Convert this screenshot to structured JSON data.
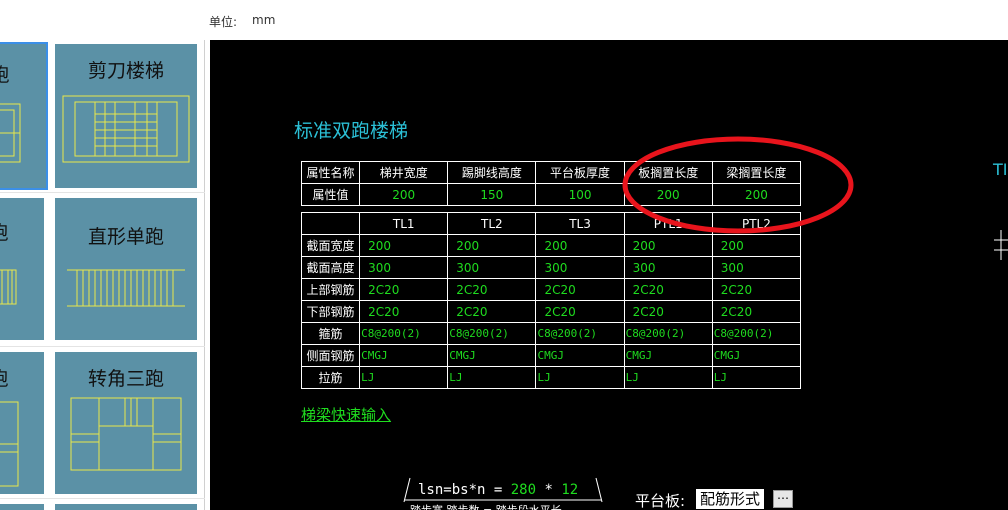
{
  "topbar": {
    "unit_label": "单位:",
    "unit_value": "mm"
  },
  "templates": [
    {
      "label": "跑",
      "selected": true
    },
    {
      "label": "剪刀楼梯"
    },
    {
      "label": "跑"
    },
    {
      "label": "直形单跑"
    },
    {
      "label": "跑"
    },
    {
      "label": "转角三跑"
    }
  ],
  "cad": {
    "title": "标准双跑楼梯",
    "properties": {
      "headers": [
        "属性名称",
        "梯井宽度",
        "踢脚线高度",
        "平台板厚度",
        "板搁置长度",
        "梁搁置长度"
      ],
      "row_label": "属性值",
      "values": [
        "200",
        "150",
        "100",
        "200",
        "200"
      ]
    },
    "beams": {
      "columns": [
        "TL1",
        "TL2",
        "TL3",
        "PTL1",
        "PTL2"
      ],
      "rows": [
        {
          "label": "截面宽度",
          "values": [
            "200",
            "200",
            "200",
            "200",
            "200"
          ]
        },
        {
          "label": "截面高度",
          "values": [
            "300",
            "300",
            "300",
            "300",
            "300"
          ]
        },
        {
          "label": "上部钢筋",
          "values": [
            "2C20",
            "2C20",
            "2C20",
            "2C20",
            "2C20"
          ]
        },
        {
          "label": "下部钢筋",
          "values": [
            "2C20",
            "2C20",
            "2C20",
            "2C20",
            "2C20"
          ]
        },
        {
          "label": "箍筋",
          "values": [
            "C8@200(2)",
            "C8@200(2)",
            "C8@200(2)",
            "C8@200(2)",
            "C8@200(2)"
          ]
        },
        {
          "label": "侧面钢筋",
          "values": [
            "CMGJ",
            "CMGJ",
            "CMGJ",
            "CMGJ",
            "CMGJ"
          ]
        },
        {
          "label": "拉筋",
          "values": [
            "LJ",
            "LJ",
            "LJ",
            "LJ",
            "LJ"
          ]
        }
      ]
    },
    "quick_link": "梯梁快速输入",
    "right_text": "TI",
    "formula": {
      "prefix": "lsn=bs*n = ",
      "bs": "280",
      "op": " * ",
      "n": "12",
      "sub": "踏步宽 踏步数 = 踏步段水平长"
    },
    "platform": {
      "label": "平台板:",
      "value": "配筋形式",
      "more": "⋯"
    }
  },
  "colors": {
    "cad_bg": "#000000",
    "value_green": "#1fdc1f",
    "title_cyan": "#2bc0d6",
    "tile_bg": "#5b91a6",
    "highlight_red": "#e8141c"
  }
}
